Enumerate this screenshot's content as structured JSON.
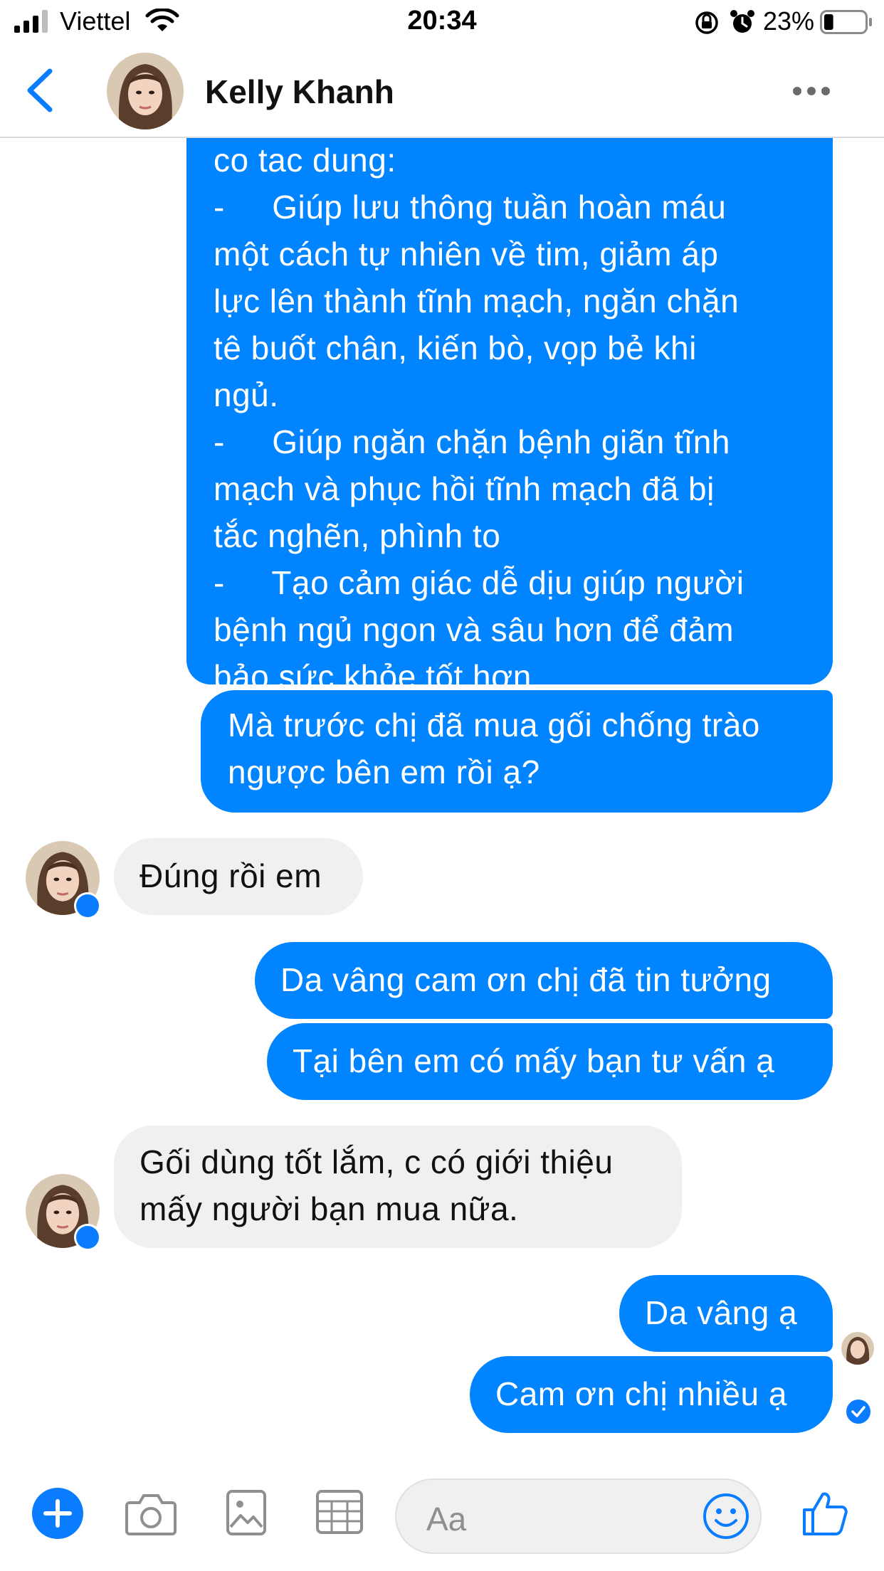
{
  "status_bar": {
    "carrier": "Viettel",
    "time": "20:34",
    "battery_percent": "23%",
    "battery_level": 0.23,
    "icons": [
      "signal-icon",
      "wifi-icon",
      "orientation-lock-icon",
      "alarm-icon",
      "battery-icon"
    ]
  },
  "header": {
    "contact_name": "Kelly Khanh",
    "back_icon": "chevron-left-icon",
    "more_icon": "more-icon"
  },
  "messages": [
    {
      "side": "out",
      "text": "co tac dung:\n-     Giúp lưu thông tuần hoàn máu\nmột cách tự nhiên về tim, giảm áp\nlực lên thành tĩnh mạch, ngăn chặn\ntê buốt chân, kiến bò, vọp bẻ khi\nngủ.\n-     Giúp ngăn chặn bệnh giãn tĩnh\nmạch và phục hồi tĩnh mạch đã bị\ntắc nghẽn, phình to\n-     Tạo cảm giác dễ dịu giúp người\nbệnh ngủ ngon và sâu hơn để đảm\nbảo sức khỏe tốt hơn"
    },
    {
      "side": "out",
      "text": "Mà trước chị đã mua gối chống trào\nngược bên em rồi ạ?"
    },
    {
      "side": "in",
      "text": "Đúng rồi em"
    },
    {
      "side": "out",
      "text": "Da vâng cam ơn chị đã tin tưởng"
    },
    {
      "side": "out",
      "text": "Tại bên em có mấy bạn tư vấn ạ"
    },
    {
      "side": "in",
      "text": "Gối dùng tốt lắm, c có giới thiệu\nmấy người bạn mua nữa."
    },
    {
      "side": "out",
      "text": "Da vâng ạ"
    },
    {
      "side": "out",
      "text": "Cam ơn chị nhiều ạ"
    }
  ],
  "composer": {
    "placeholder": "Aa",
    "icons": [
      "plus-icon",
      "camera-icon",
      "image-icon",
      "sticker-icon",
      "emoji-icon",
      "like-icon"
    ]
  },
  "colors": {
    "accent": "#0084ff",
    "incoming_bubble": "#f1f0f0",
    "header_border": "#d9d9d9"
  }
}
